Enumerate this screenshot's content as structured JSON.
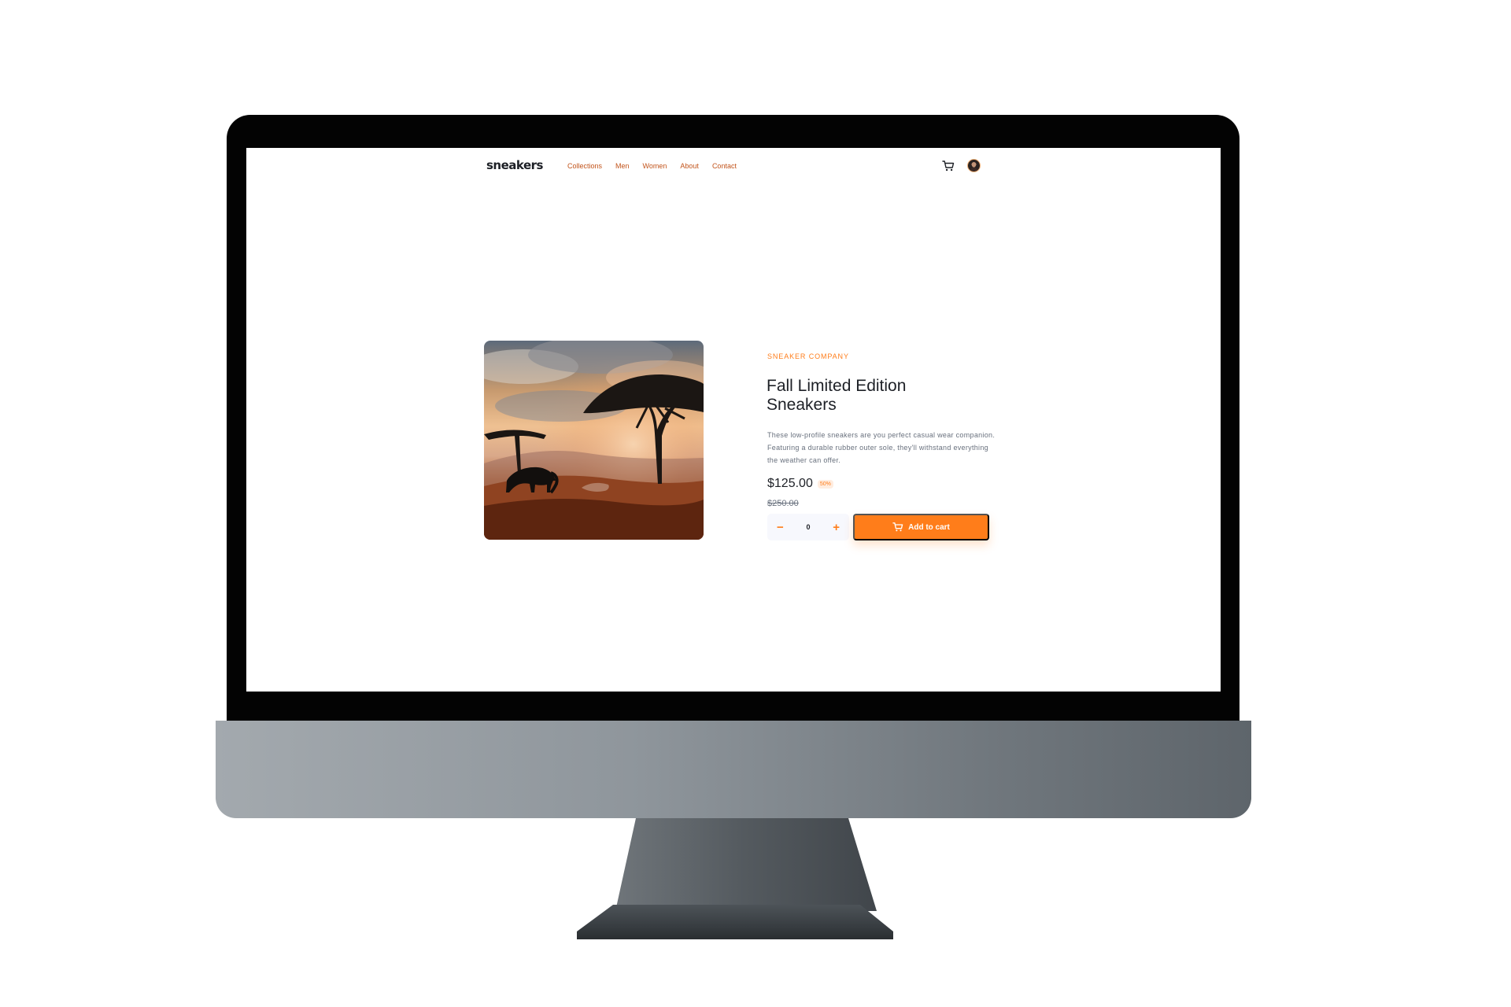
{
  "site": {
    "logo": "sneakers",
    "nav": [
      "Collections",
      "Men",
      "Women",
      "About",
      "Contact"
    ],
    "icons": {
      "cart": "cart-icon",
      "avatar": "avatar"
    }
  },
  "product": {
    "brand": "SNEAKER COMPANY",
    "title": "Fall Limited Edition Sneakers",
    "description": "These low-profile sneakers are you perfect casual wear companion. Featuring a durable rubber outer sole, they'll withstand everything the weather can offer.",
    "price": "$125.00",
    "discount": "50%",
    "old_price": "$250.00",
    "quantity": "0",
    "minus": "−",
    "plus": "+",
    "add_to_cart": "Add to cart"
  },
  "colors": {
    "accent": "#ff7d1a",
    "nav_text": "#c2541b",
    "dark_text": "#1d2026",
    "muted_text": "#68707d"
  }
}
